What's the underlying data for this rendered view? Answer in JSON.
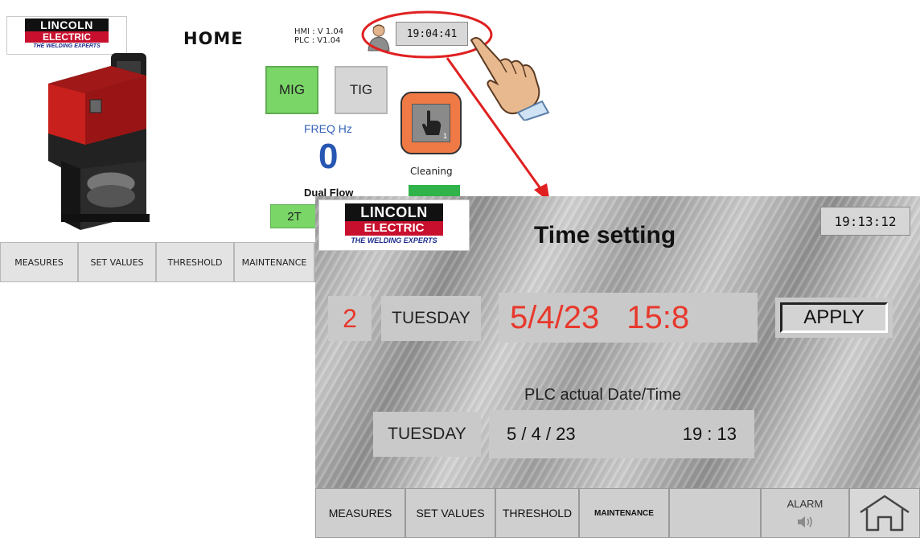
{
  "logo": {
    "line1": "LINCOLN",
    "line2": "ELECTRIC",
    "tagline": "THE WELDING EXPERTS"
  },
  "home": {
    "title": "HOME",
    "hmi_version": "HMI : V 1.04",
    "plc_version": "PLC : V1.04",
    "clock": "19:04:41",
    "mig_label": "MIG",
    "tig_label": "TIG",
    "freq_label": "FREQ Hz",
    "freq_value": "0",
    "cleaning_label": "Cleaning",
    "cleaning_badge": "1",
    "dual_flow_label": "Dual Flow",
    "trigger_mode": "2T",
    "nav": [
      "MEASURES",
      "SET VALUES",
      "THRESHOLD",
      "MAINTENANCE"
    ]
  },
  "time_setting": {
    "title": "Time setting",
    "clock": "19:13:12",
    "day_number": "2",
    "day_name": "TUESDAY",
    "set_date": "5/4/23",
    "set_time": "15:8",
    "apply_label": "APPLY",
    "plc_label": "PLC actual Date/Time",
    "plc_day": "TUESDAY",
    "plc_date": "5 / 4 / 23",
    "plc_time": "19 : 13",
    "nav": [
      "MEASURES",
      "SET VALUES",
      "THRESHOLD",
      "MAINTENANCE"
    ],
    "alarm_label": "ALARM"
  },
  "colors": {
    "active_green": "#7ad667",
    "accent_red": "#e8382c",
    "freq_blue": "#2756b3",
    "cleaning_orange": "#f07a45",
    "callout_red": "#e02020"
  },
  "icons": [
    "user-icon",
    "hand-pointer-icon",
    "speaker-icon",
    "home-icon"
  ]
}
